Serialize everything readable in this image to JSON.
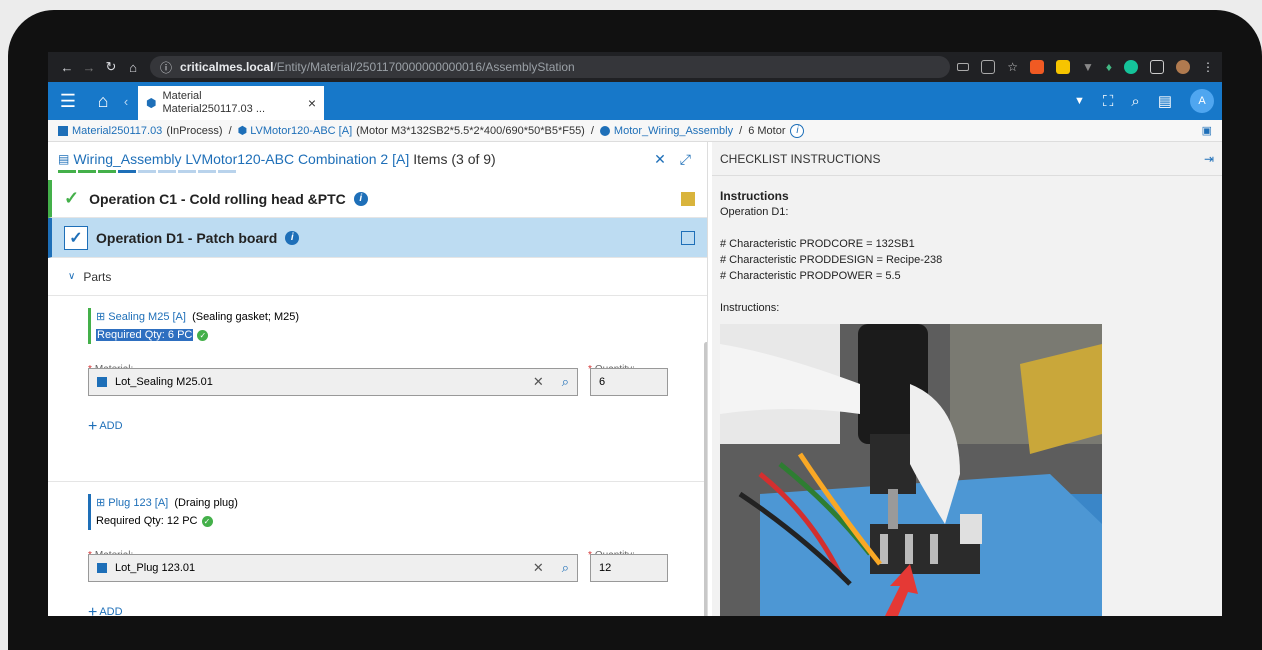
{
  "browser": {
    "url_host": "criticalmes.local",
    "url_path": "/Entity/Material/2501170000000000016/AssemblyStation"
  },
  "tab": {
    "line1": "Material",
    "line2": "Material250117.03 ...",
    "close": "×"
  },
  "header": {
    "avatar": "A"
  },
  "breadcrumb": {
    "material": "Material250117.03",
    "material_state": "(InProcess)",
    "product": "LVMotor120-ABC [A]",
    "product_desc": "(Motor M3*132SB2*5.5*2*400/690*50*B5*F55)",
    "flow": "Motor_Wiring_Assembly",
    "step": "6 Motor",
    "separator": "/"
  },
  "task": {
    "title": "Wiring_Assembly LVMotor120-ABC Combination 2 [A]",
    "count": "Items (3 of 9)"
  },
  "operations": [
    {
      "label": "Operation C1 - Cold rolling head &PTC"
    },
    {
      "label": "Operation D1 - Patch board"
    }
  ],
  "parts_label": "Parts",
  "parts": [
    {
      "link": "Sealing M25 [A]",
      "desc": "(Sealing gasket; M25)",
      "required": "Required Qty: 6 PC",
      "material_label": "Material:",
      "quantity_label": "Quantity:",
      "material_value": "Lot_Sealing M25.01",
      "quantity_value": "6",
      "add_label": "ADD"
    },
    {
      "link": "Plug 123 [A]",
      "desc": "(Draing plug)",
      "required": "Required Qty: 12 PC",
      "material_label": "Material:",
      "quantity_label": "Quantity:",
      "material_value": "Lot_Plug 123.01",
      "quantity_value": "12",
      "add_label": "ADD"
    }
  ],
  "checklist": {
    "title": "CHECKLIST INSTRUCTIONS",
    "heading": "Instructions",
    "operation": "Operation D1:",
    "lines": [
      "# Characteristic PRODCORE = 132SB1",
      "# Characteristic PRODDESIGN = Recipe-238",
      "# Characteristic PRODPOWER = 5.5"
    ],
    "sub_heading": "Instructions:"
  },
  "colors": {
    "brand": "#1778c9",
    "link": "#1e6fb8",
    "success": "#44b04a",
    "selected": "#bddcf2"
  }
}
